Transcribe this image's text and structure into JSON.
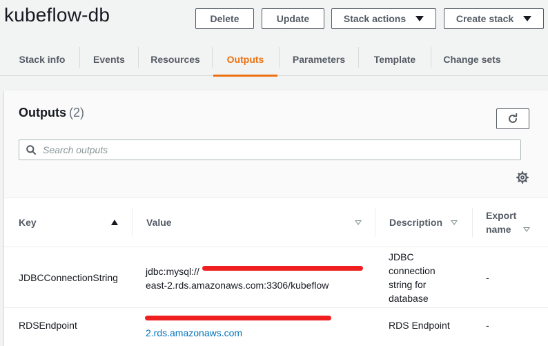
{
  "stack": {
    "name": "kubeflow-db"
  },
  "actions": {
    "delete_label": "Delete",
    "update_label": "Update",
    "stack_actions_label": "Stack actions",
    "create_stack_label": "Create stack"
  },
  "tabs": [
    {
      "label": "Stack info"
    },
    {
      "label": "Events"
    },
    {
      "label": "Resources"
    },
    {
      "label": "Outputs",
      "active": true
    },
    {
      "label": "Parameters"
    },
    {
      "label": "Template"
    },
    {
      "label": "Change sets"
    }
  ],
  "outputs": {
    "title": "Outputs",
    "count": "(2)",
    "search_placeholder": "Search outputs"
  },
  "table": {
    "columns": {
      "key": "Key",
      "value": "Value",
      "description": "Description",
      "export_line1": "Export",
      "export_line2": "name"
    },
    "rows": [
      {
        "key": "JDBCConnectionString",
        "value_line1": "jdbc:mysql://",
        "value_line2": "east-2.rds.amazonaws.com:3306/kubeflow",
        "description_lines": [
          "JDBC",
          "connection",
          "string for",
          "database"
        ],
        "export": "-"
      },
      {
        "key": "RDSEndpoint",
        "value_line2": "2.rds.amazonaws.com",
        "description": "RDS Endpoint",
        "export": "-"
      }
    ]
  },
  "colors": {
    "accent": "#ec7211",
    "link": "#0073bb",
    "redaction": "#ef1f1f"
  },
  "icons": [
    "caret-down-icon",
    "refresh-icon",
    "search-icon",
    "gear-icon",
    "sort-ascending-icon",
    "sort-descending-icon"
  ]
}
